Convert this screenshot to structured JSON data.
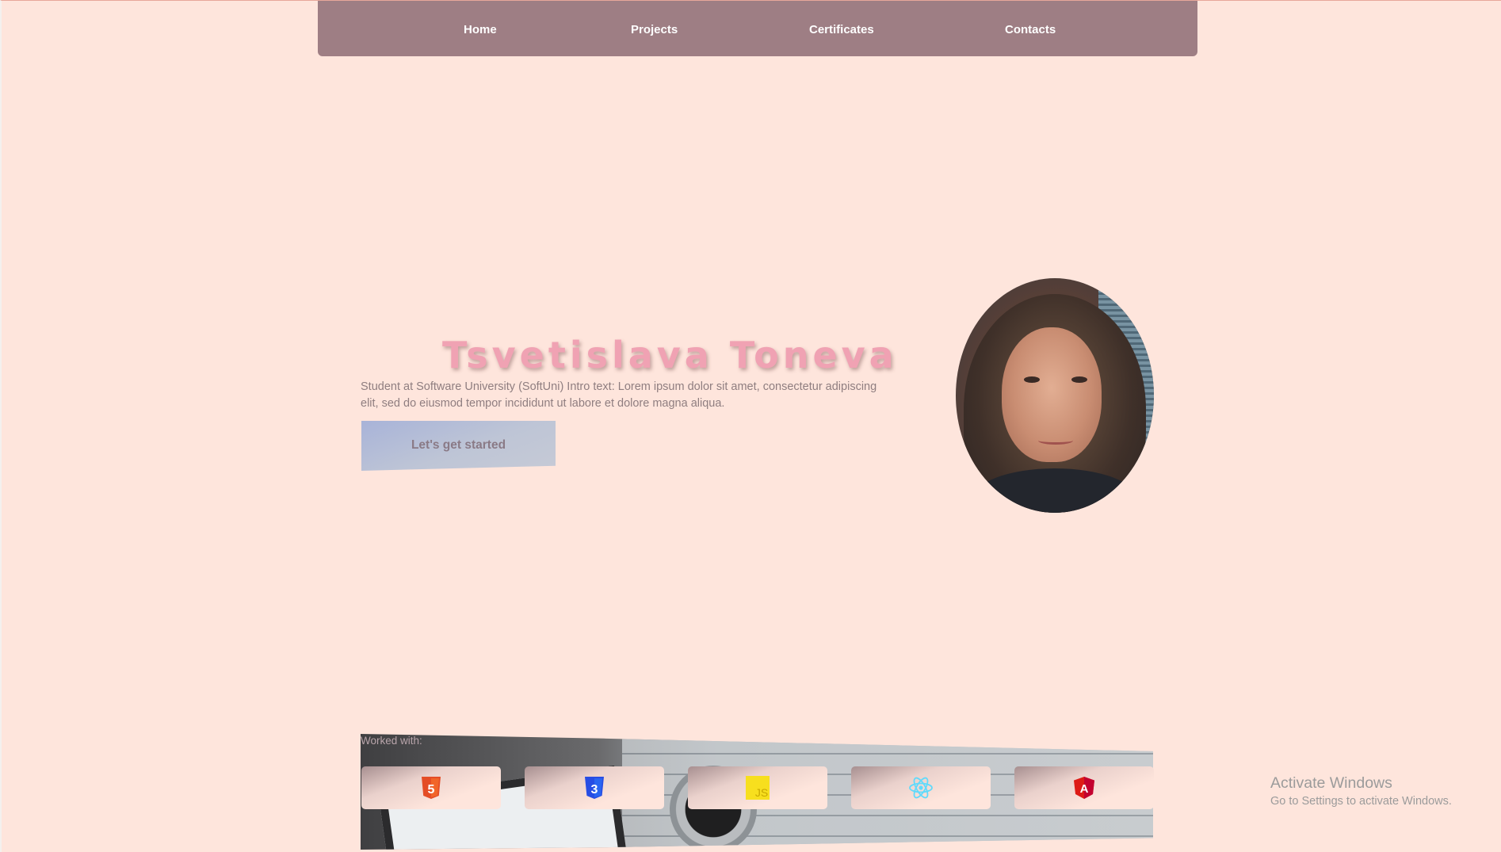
{
  "nav": {
    "items": [
      {
        "label": "Home"
      },
      {
        "label": "Projects"
      },
      {
        "label": "Certificates"
      },
      {
        "label": "Contacts"
      }
    ]
  },
  "hero": {
    "title": "Tsvetislava Toneva",
    "intro": "Student at Software University (SoftUni) Intro text: Lorem ipsum dolor sit amet, consectetur adipiscing elit, sed do eiusmod tempor incididunt ut labore et dolore magna aliqua.",
    "cta_label": "Let's get started"
  },
  "worked_with": {
    "label": "Worked with:",
    "technologies": [
      {
        "name": "html5-icon",
        "glyph": "5",
        "color": "#e44d26"
      },
      {
        "name": "css3-icon",
        "glyph": "3",
        "color": "#264de4"
      },
      {
        "name": "javascript-icon",
        "glyph": "JS",
        "color": "#f7df1e"
      },
      {
        "name": "react-icon",
        "glyph": "",
        "color": "#61dafb"
      },
      {
        "name": "angular-icon",
        "glyph": "A",
        "color": "#dd1b16"
      }
    ]
  },
  "windows_notice": {
    "title": "Activate Windows",
    "subtitle": "Go to Settings to activate Windows."
  }
}
